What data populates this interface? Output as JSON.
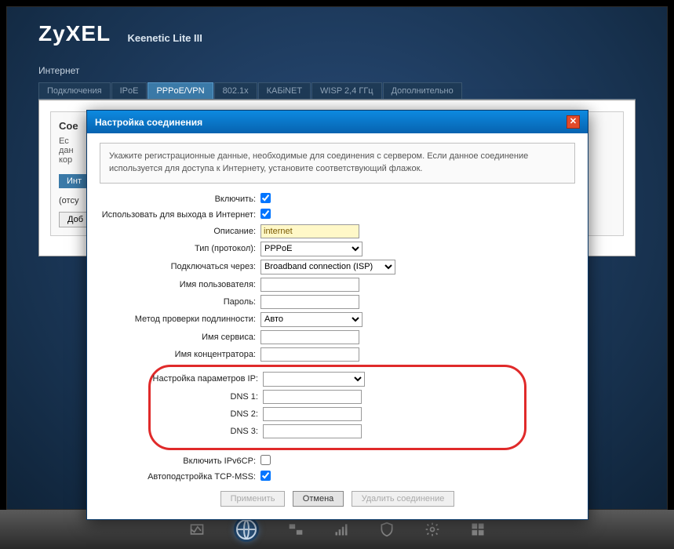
{
  "brand": "ZyXEL",
  "model": "Keenetic Lite III",
  "breadcrumb": "Интернет",
  "tabs": [
    {
      "label": "Подключения"
    },
    {
      "label": "IPoE"
    },
    {
      "label": "PPPoE/VPN",
      "active": true
    },
    {
      "label": "802.1x"
    },
    {
      "label": "КАБiNET"
    },
    {
      "label": "WISP 2,4 ГГц"
    },
    {
      "label": "Дополнительно"
    }
  ],
  "panel": {
    "title": "Сое",
    "text1": "Ес",
    "text2": "дан",
    "text3": "кор",
    "intTab": "Инт",
    "status": "(отсу",
    "addBtn": "Доб"
  },
  "modal": {
    "title": "Настройка соединения",
    "help": "Укажите регистрационные данные, необходимые для соединения с сервером. Если данное соединение используется для доступа к Интернету, установите соответствующий флажок.",
    "labels": {
      "enable": "Включить:",
      "useForInternet": "Использовать для выхода в Интернет:",
      "description": "Описание:",
      "protocol": "Тип (протокол):",
      "connectVia": "Подключаться через:",
      "username": "Имя пользователя:",
      "password": "Пароль:",
      "authMethod": "Метод проверки подлинности:",
      "serviceName": "Имя сервиса:",
      "concentratorName": "Имя концентратора:",
      "ipConfig": "Настройка параметров IP:",
      "dns1": "DNS 1:",
      "dns2": "DNS 2:",
      "dns3": "DNS 3:",
      "ipv6cp": "Включить IPv6CP:",
      "tcpmss": "Автоподстройка TCP-MSS:"
    },
    "values": {
      "enable": true,
      "useForInternet": true,
      "description": "internet",
      "protocol": "PPPoE",
      "connectVia": "Broadband connection (ISP)",
      "username": "",
      "password": "",
      "authMethod": "Авто",
      "serviceName": "",
      "concentratorName": "",
      "ipConfig": "",
      "dns1": "",
      "dns2": "",
      "dns3": "",
      "ipv6cp": false,
      "tcpmss": true
    },
    "buttons": {
      "apply": "Применить",
      "cancel": "Отмена",
      "delete": "Удалить соединение"
    }
  }
}
